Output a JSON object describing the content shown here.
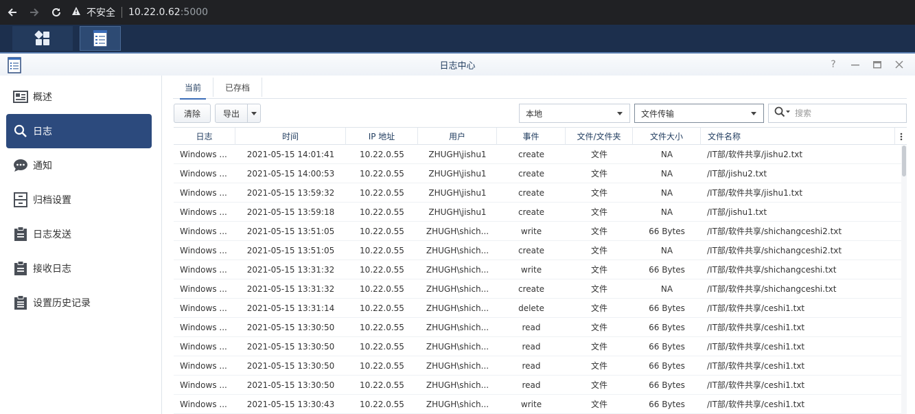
{
  "browser": {
    "security_label": "不安全",
    "host": "10.22.0.62",
    "port": ":5000"
  },
  "window": {
    "title": "日志中心",
    "controls": [
      "help-icon",
      "minimize-icon",
      "maximize-icon",
      "close-icon"
    ]
  },
  "sidebar": {
    "items": [
      {
        "label": "概述",
        "icon": "overview-icon"
      },
      {
        "label": "日志",
        "icon": "search-icon",
        "active": true
      },
      {
        "label": "通知",
        "icon": "chat-bubble-icon"
      },
      {
        "label": "归档设置",
        "icon": "cabinet-icon"
      },
      {
        "label": "日志发送",
        "icon": "clipboard-send-icon"
      },
      {
        "label": "接收日志",
        "icon": "clipboard-receive-icon"
      },
      {
        "label": "设置历史记录",
        "icon": "clipboard-history-icon"
      }
    ]
  },
  "tabs": [
    {
      "label": "当前",
      "active": true
    },
    {
      "label": "已存档"
    }
  ],
  "toolbar": {
    "clear_label": "清除",
    "export_label": "导出",
    "source_value": "本地",
    "type_value": "文件传输",
    "search_placeholder": "搜索"
  },
  "table": {
    "columns": [
      "日志",
      "时间",
      "IP 地址",
      "用户",
      "事件",
      "文件/文件夹",
      "文件大小",
      "文件名称"
    ],
    "rows": [
      [
        "Windows ...",
        "2021-05-15 14:01:41",
        "10.22.0.55",
        "ZHUGH\\jishu1",
        "create",
        "文件",
        "NA",
        "/IT部/软件共享/jishu2.txt"
      ],
      [
        "Windows ...",
        "2021-05-15 14:00:53",
        "10.22.0.55",
        "ZHUGH\\jishu1",
        "create",
        "文件",
        "NA",
        "/IT部/jishu2.txt"
      ],
      [
        "Windows ...",
        "2021-05-15 13:59:32",
        "10.22.0.55",
        "ZHUGH\\jishu1",
        "create",
        "文件",
        "NA",
        "/IT部/软件共享/jishu1.txt"
      ],
      [
        "Windows ...",
        "2021-05-15 13:59:18",
        "10.22.0.55",
        "ZHUGH\\jishu1",
        "create",
        "文件",
        "NA",
        "/IT部/jishu1.txt"
      ],
      [
        "Windows ...",
        "2021-05-15 13:51:05",
        "10.22.0.55",
        "ZHUGH\\shich...",
        "write",
        "文件",
        "66 Bytes",
        "/IT部/软件共享/shichangceshi2.txt"
      ],
      [
        "Windows ...",
        "2021-05-15 13:51:05",
        "10.22.0.55",
        "ZHUGH\\shich...",
        "create",
        "文件",
        "NA",
        "/IT部/软件共享/shichangceshi2.txt"
      ],
      [
        "Windows ...",
        "2021-05-15 13:31:32",
        "10.22.0.55",
        "ZHUGH\\shich...",
        "write",
        "文件",
        "66 Bytes",
        "/IT部/软件共享/shichangceshi.txt"
      ],
      [
        "Windows ...",
        "2021-05-15 13:31:32",
        "10.22.0.55",
        "ZHUGH\\shich...",
        "create",
        "文件",
        "NA",
        "/IT部/软件共享/shichangceshi.txt"
      ],
      [
        "Windows ...",
        "2021-05-15 13:31:14",
        "10.22.0.55",
        "ZHUGH\\shich...",
        "delete",
        "文件",
        "66 Bytes",
        "/IT部/软件共享/ceshi1.txt"
      ],
      [
        "Windows ...",
        "2021-05-15 13:30:50",
        "10.22.0.55",
        "ZHUGH\\shich...",
        "read",
        "文件",
        "66 Bytes",
        "/IT部/软件共享/ceshi1.txt"
      ],
      [
        "Windows ...",
        "2021-05-15 13:30:50",
        "10.22.0.55",
        "ZHUGH\\shich...",
        "read",
        "文件",
        "66 Bytes",
        "/IT部/软件共享/ceshi1.txt"
      ],
      [
        "Windows ...",
        "2021-05-15 13:30:50",
        "10.22.0.55",
        "ZHUGH\\shich...",
        "read",
        "文件",
        "66 Bytes",
        "/IT部/软件共享/ceshi1.txt"
      ],
      [
        "Windows ...",
        "2021-05-15 13:30:50",
        "10.22.0.55",
        "ZHUGH\\shich...",
        "read",
        "文件",
        "66 Bytes",
        "/IT部/软件共享/ceshi1.txt"
      ],
      [
        "Windows ...",
        "2021-05-15 13:30:43",
        "10.22.0.55",
        "ZHUGH\\shich...",
        "write",
        "文件",
        "66 Bytes",
        "/IT部/软件共享/ceshi1.txt"
      ]
    ]
  }
}
